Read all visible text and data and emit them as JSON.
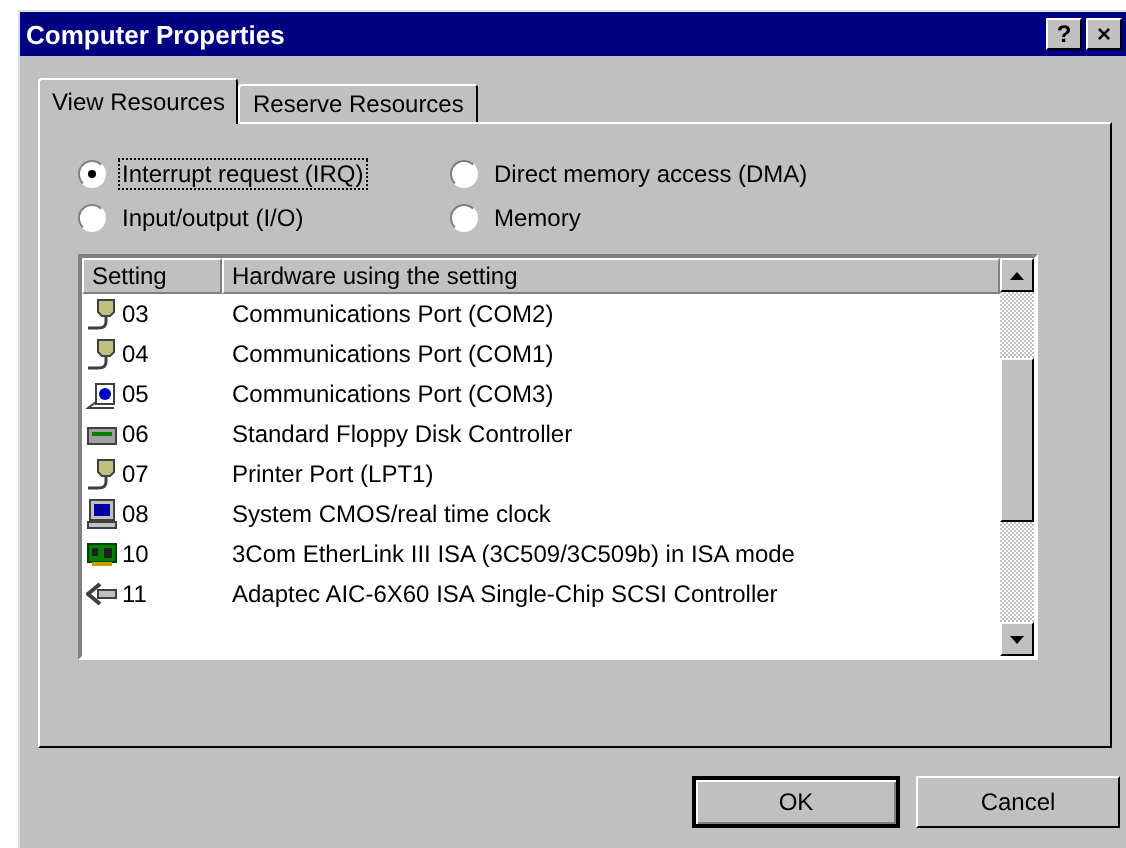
{
  "window": {
    "title": "Computer Properties",
    "help_button": "?",
    "close_button": "×"
  },
  "tabs": [
    {
      "label": "View Resources",
      "selected": true
    },
    {
      "label": "Reserve Resources",
      "selected": false
    }
  ],
  "radios": [
    {
      "label": "Interrupt request (IRQ)",
      "selected": true
    },
    {
      "label": "Direct memory access (DMA)",
      "selected": false
    },
    {
      "label": "Input/output (I/O)",
      "selected": false
    },
    {
      "label": "Memory",
      "selected": false
    }
  ],
  "list": {
    "columns": [
      "Setting",
      "Hardware using the setting"
    ],
    "rows": [
      {
        "kind": "port",
        "setting": "03",
        "hardware": "Communications Port (COM2)"
      },
      {
        "kind": "port",
        "setting": "04",
        "hardware": "Communications Port (COM1)"
      },
      {
        "kind": "modem",
        "setting": "05",
        "hardware": "Communications Port (COM3)"
      },
      {
        "kind": "floppy",
        "setting": "06",
        "hardware": "Standard Floppy Disk Controller"
      },
      {
        "kind": "port",
        "setting": "07",
        "hardware": "Printer Port (LPT1)"
      },
      {
        "kind": "computer",
        "setting": "08",
        "hardware": "System CMOS/real time clock"
      },
      {
        "kind": "card",
        "setting": "10",
        "hardware": "3Com EtherLink III ISA (3C509/3C509b) in ISA mode"
      },
      {
        "kind": "scsi",
        "setting": "11",
        "hardware": "Adaptec AIC-6X60 ISA Single-Chip SCSI Controller"
      }
    ]
  },
  "buttons": [
    {
      "label": "OK",
      "default": true
    },
    {
      "label": "Cancel",
      "default": false
    }
  ]
}
